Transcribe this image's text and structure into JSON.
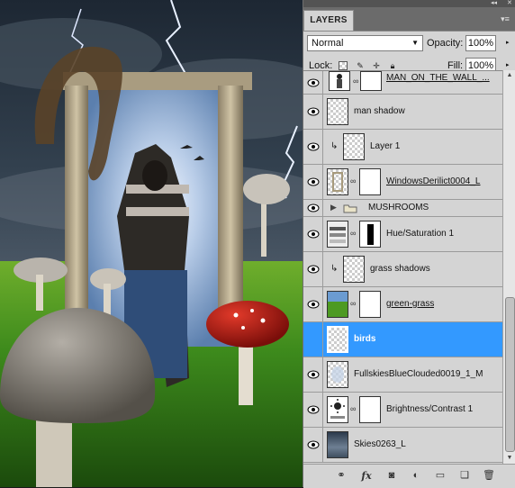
{
  "panel": {
    "tab_label": "LAYERS",
    "blend_mode": "Normal",
    "opacity_label": "Opacity:",
    "opacity_value": "100%",
    "lock_label": "Lock:",
    "fill_label": "Fill:",
    "fill_value": "100%"
  },
  "layers": [
    {
      "name": "MAN_ON_THE_WALL_...",
      "visible": true,
      "selected": false,
      "underline": true
    },
    {
      "name": "man shadow",
      "visible": true,
      "selected": false
    },
    {
      "name": "Layer 1",
      "visible": true,
      "selected": false,
      "clipped": true
    },
    {
      "name": "WindowsDerilict0004_L",
      "visible": true,
      "selected": false,
      "underline": true
    },
    {
      "name": "MUSHROOMS",
      "visible": true,
      "selected": false,
      "group": true
    },
    {
      "name": "Hue/Saturation 1",
      "visible": true,
      "selected": false
    },
    {
      "name": "grass shadows",
      "visible": true,
      "selected": false,
      "clipped": true
    },
    {
      "name": "green-grass",
      "visible": true,
      "selected": false,
      "underline": true
    },
    {
      "name": "birds",
      "visible": false,
      "selected": true
    },
    {
      "name": "FullskiesBlueClouded0019_1_M",
      "visible": true,
      "selected": false
    },
    {
      "name": "Brightness/Contrast 1",
      "visible": true,
      "selected": false
    },
    {
      "name": "Skies0263_L",
      "visible": true,
      "selected": false
    }
  ],
  "footer_icons": [
    "link-layers-icon",
    "fx-icon",
    "add-mask-icon",
    "adjustment-layer-icon",
    "new-group-icon",
    "new-layer-icon",
    "delete-layer-icon"
  ],
  "footer": {
    "fx_label": "fx"
  },
  "colors": {
    "selection": "#3399ff",
    "panel_bg": "#d4d4d4",
    "tab_bar": "#6b6b6b"
  }
}
